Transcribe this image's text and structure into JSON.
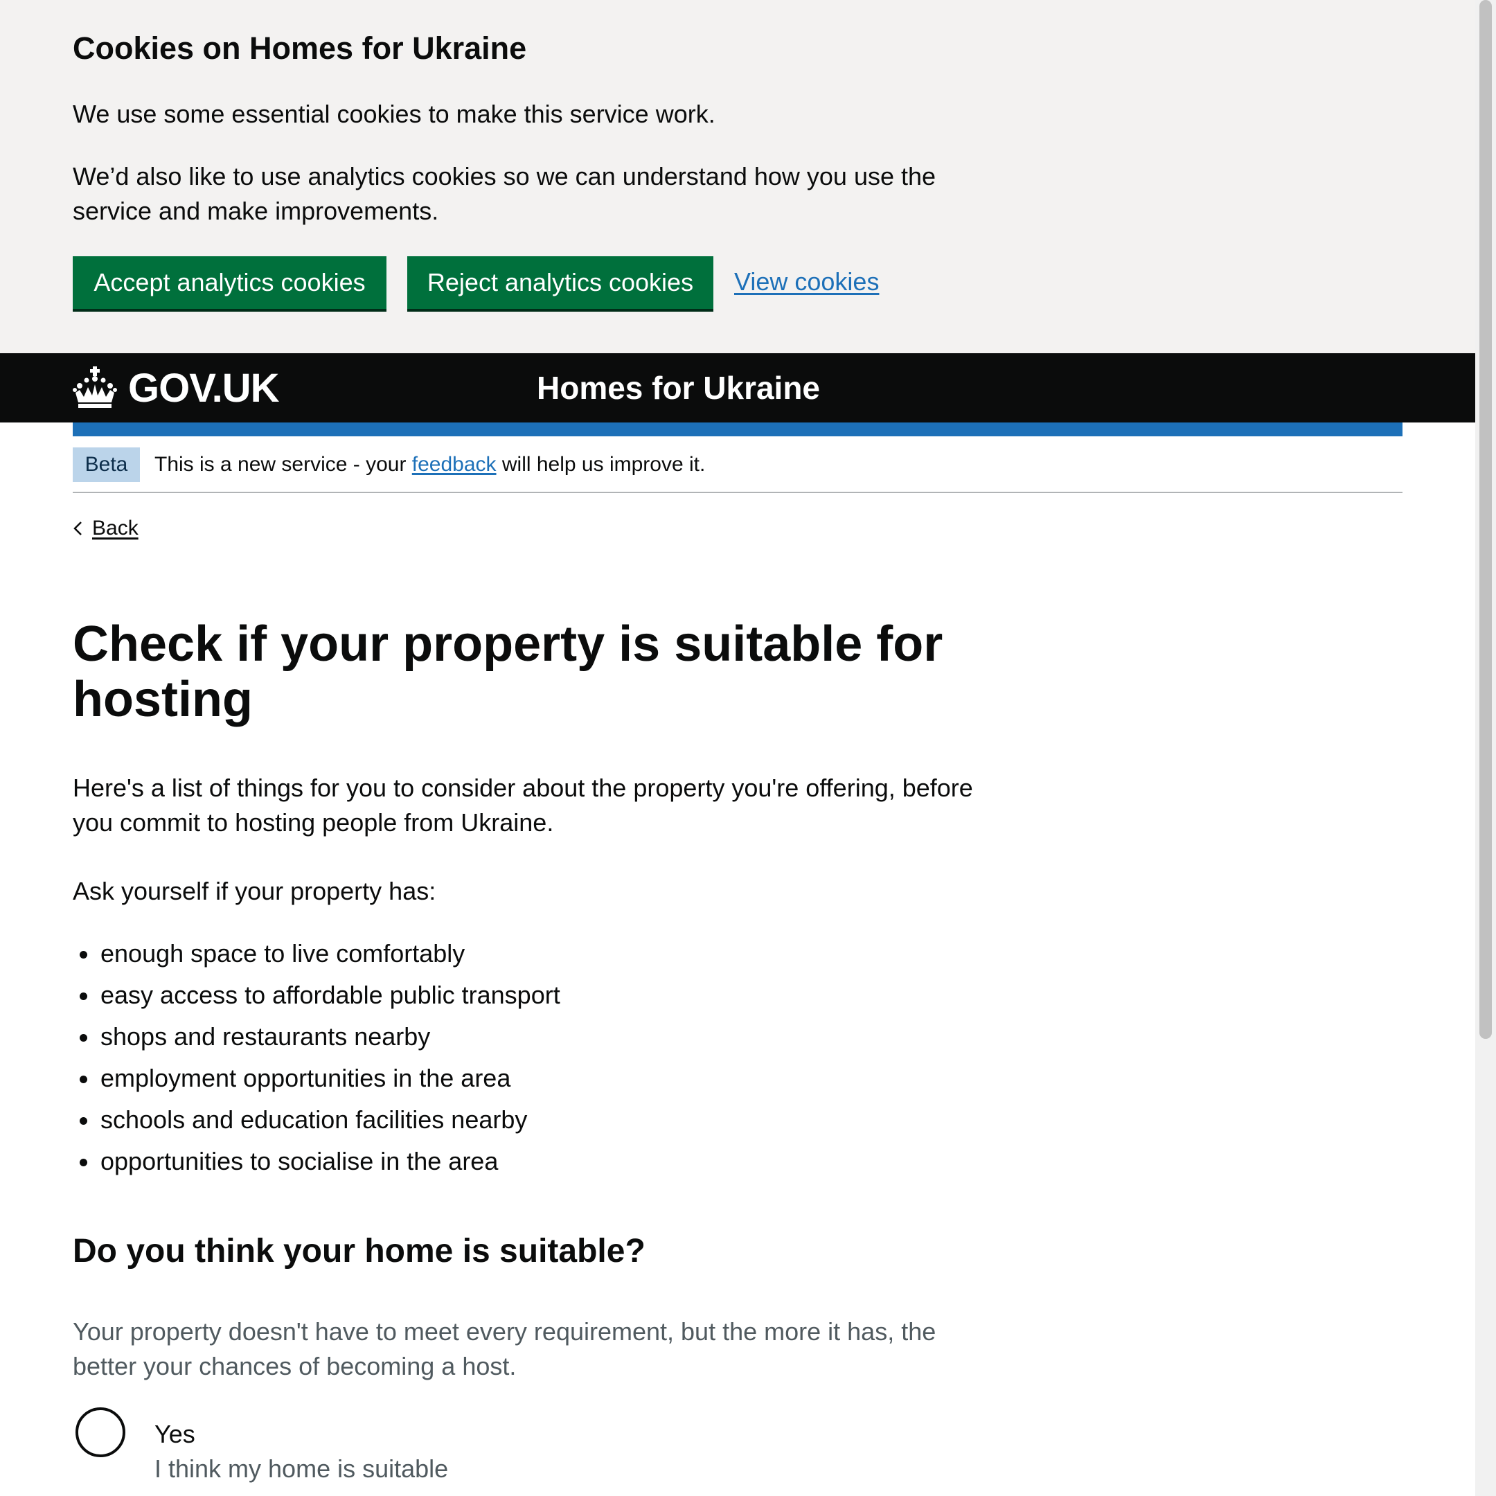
{
  "cookie_banner": {
    "title": "Cookies on Homes for Ukraine",
    "paragraph_1": "We use some essential cookies to make this service work.",
    "paragraph_2": "We’d also like to use analytics cookies so we can understand how you use the service and make improvements.",
    "accept_label": "Accept analytics cookies",
    "reject_label": "Reject analytics cookies",
    "view_label": "View cookies"
  },
  "header": {
    "logo_text": "GOV.UK",
    "logo_icon": "crown-icon",
    "service_name": "Homes for Ukraine"
  },
  "phase_banner": {
    "tag": "Beta",
    "text_before": "This is a new service - your ",
    "link_text": "feedback",
    "text_after": " will help us improve it."
  },
  "back_link": {
    "label": "Back",
    "icon": "chevron-left-icon"
  },
  "main": {
    "title": "Check if your property is suitable for hosting",
    "intro": "Here's a list of things for you to consider about the property you're offering, before you commit to hosting people from Ukraine.",
    "ask": "Ask yourself if your property has:",
    "bullets": [
      "enough space to live comfortably",
      "easy access to affordable public transport",
      "shops and restaurants nearby",
      "employment opportunities in the area",
      "schools and education facilities nearby",
      "opportunities to socialise in the area"
    ],
    "question": "Do you think your home is suitable?",
    "hint": "Your property doesn't have to meet every requirement, but the more it has, the better your chances of becoming a host.",
    "options": [
      {
        "label": "Yes",
        "hint": "I think my home is suitable",
        "selected": false
      }
    ]
  },
  "colors": {
    "button_green": "#00703c",
    "link_blue": "#1d70b8",
    "header_black": "#0b0c0c",
    "banner_grey": "#f3f2f1",
    "hint_grey": "#505a5f",
    "beta_tag_bg": "#bbd4ea"
  }
}
